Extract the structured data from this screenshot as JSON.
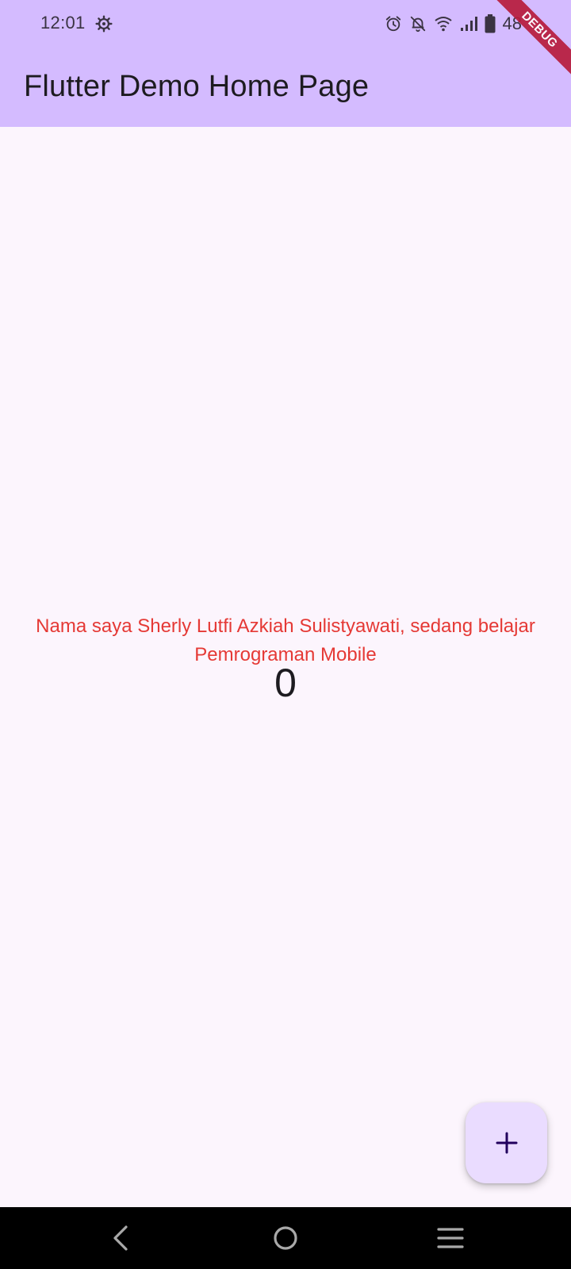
{
  "status_bar": {
    "time": "12:01",
    "battery_text": "48",
    "icons": [
      "settings-gear-icon",
      "alarm-icon",
      "notifications-off-icon",
      "wifi-icon",
      "signal-icon",
      "battery-icon"
    ]
  },
  "app_bar": {
    "title": "Flutter Demo Home Page",
    "background_color": "#d4bbff"
  },
  "debug_banner": {
    "label": "DEBUG",
    "color": "#b71c3c"
  },
  "main": {
    "message": "Nama saya Sherly Lutfi Azkiah Sulistyawati, sedang belajar Pemrograman Mobile",
    "message_color": "#e53935",
    "counter": "0"
  },
  "fab": {
    "icon": "plus-icon",
    "background_color": "#eadcff"
  },
  "nav_bar": {
    "icons": [
      "back-icon",
      "home-icon",
      "recent-apps-icon"
    ]
  }
}
